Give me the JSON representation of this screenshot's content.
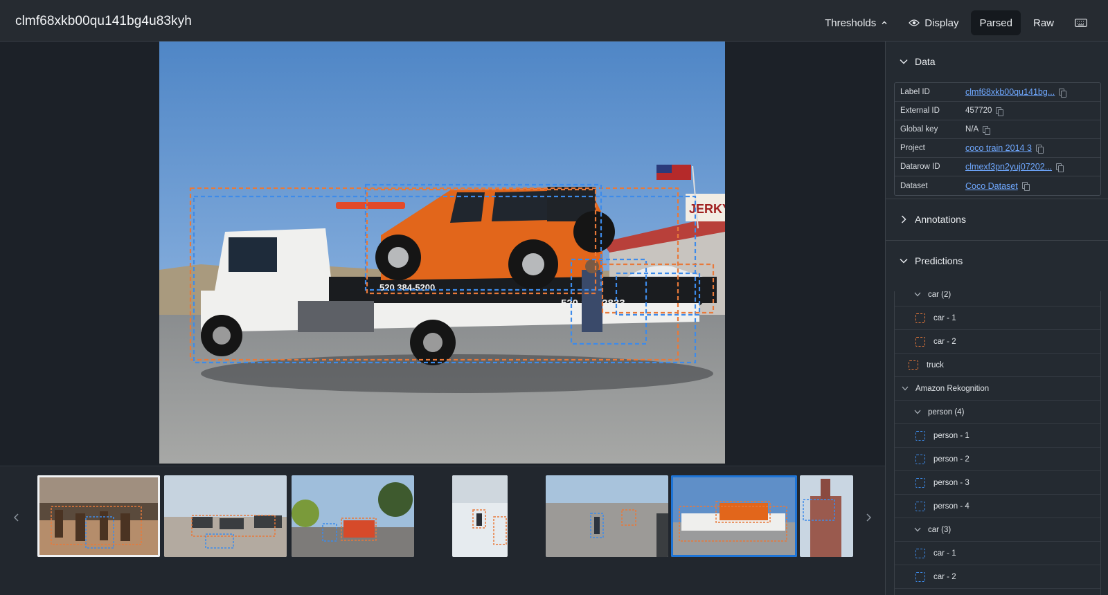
{
  "header": {
    "title": "clmf68xkb00qu141bg4u83kyh",
    "thresholds_label": "Thresholds",
    "display_label": "Display",
    "parsed_label": "Parsed",
    "raw_label": "Raw"
  },
  "panel": {
    "data_title": "Data",
    "rows": [
      {
        "key": "Label ID",
        "value": "clmf68xkb00qu141bg..."
      },
      {
        "key": "External ID",
        "value": "457720"
      },
      {
        "key": "Global key",
        "value": "N/A"
      },
      {
        "key": "Project",
        "value": "coco train 2014 3"
      },
      {
        "key": "Datarow ID",
        "value": "clmexf3pn2yuj07202..."
      },
      {
        "key": "Dataset",
        "value": "Coco Dataset"
      }
    ],
    "annotations_title": "Annotations",
    "predictions_title": "Predictions",
    "predictions": [
      {
        "label": "car (2)"
      },
      {
        "label": "car - 1"
      },
      {
        "label": "car - 2"
      },
      {
        "label": "truck"
      },
      {
        "label": "Amazon Rekognition"
      },
      {
        "label": "person (4)"
      },
      {
        "label": "person - 1"
      },
      {
        "label": "person - 2"
      },
      {
        "label": "person - 3"
      },
      {
        "label": "person - 4"
      },
      {
        "label": "car (3)"
      },
      {
        "label": "car - 1"
      },
      {
        "label": "car - 2"
      }
    ]
  },
  "image": {
    "truck_text_1": "520 384-5200",
    "truck_text_2": "520 384-2833",
    "sign_text": "JERKY"
  },
  "colors": {
    "orange_box": "#e8793a",
    "blue_box": "#3d8bea",
    "link": "#6fa8ff"
  }
}
